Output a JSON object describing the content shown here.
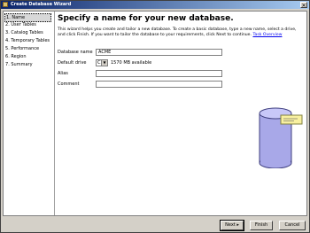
{
  "window": {
    "title": "Create Database Wizard"
  },
  "nav": {
    "items": [
      {
        "num": "1",
        "label": "Name"
      },
      {
        "num": "2",
        "label": "User Tables"
      },
      {
        "num": "3",
        "label": "Catalog Tables"
      },
      {
        "num": "4",
        "label": "Temporary Tables"
      },
      {
        "num": "5",
        "label": "Performance"
      },
      {
        "num": "6",
        "label": "Region"
      },
      {
        "num": "7",
        "label": "Summary"
      }
    ]
  },
  "main": {
    "heading": "Specify a name for your new database.",
    "description": "This wizard helps you create and tailor a new database. To create a basic database, type a new name, select a drive, and click Finish. If you want to tailor the database to your requirements, click Next to continue.",
    "link": "Task Overview",
    "fields": {
      "database_name_label": "Database name",
      "database_name_value": "ACME",
      "default_drive_label": "Default drive",
      "default_drive_value": "C:",
      "available": "1570 MB available",
      "alias_label": "Alias",
      "alias_value": "",
      "comment_label": "Comment",
      "comment_value": ""
    }
  },
  "buttons": {
    "next": "Next",
    "finish": "Finish",
    "cancel": "Cancel"
  }
}
